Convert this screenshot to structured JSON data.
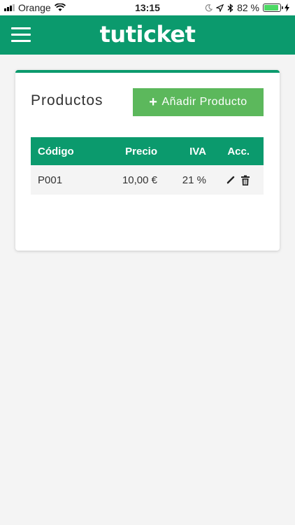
{
  "status_bar": {
    "carrier": "Orange",
    "time": "13:15",
    "battery_percent": "82 %"
  },
  "app": {
    "brand": "tuticket",
    "colors": {
      "primary": "#0b9a6d",
      "button": "#5cb85c"
    }
  },
  "card": {
    "title": "Productos",
    "add_button_label": "Añadir Producto"
  },
  "table": {
    "headers": {
      "code": "Código",
      "price": "Precio",
      "iva": "IVA",
      "actions": "Acc."
    },
    "rows": [
      {
        "code": "P001",
        "price": "10,00 €",
        "iva": "21 %"
      }
    ]
  },
  "icons": [
    "signal-icon",
    "wifi-icon",
    "moon-icon",
    "location-icon",
    "bluetooth-icon",
    "battery-icon",
    "charging-icon",
    "menu-icon",
    "plus-icon",
    "edit-icon",
    "delete-icon"
  ]
}
